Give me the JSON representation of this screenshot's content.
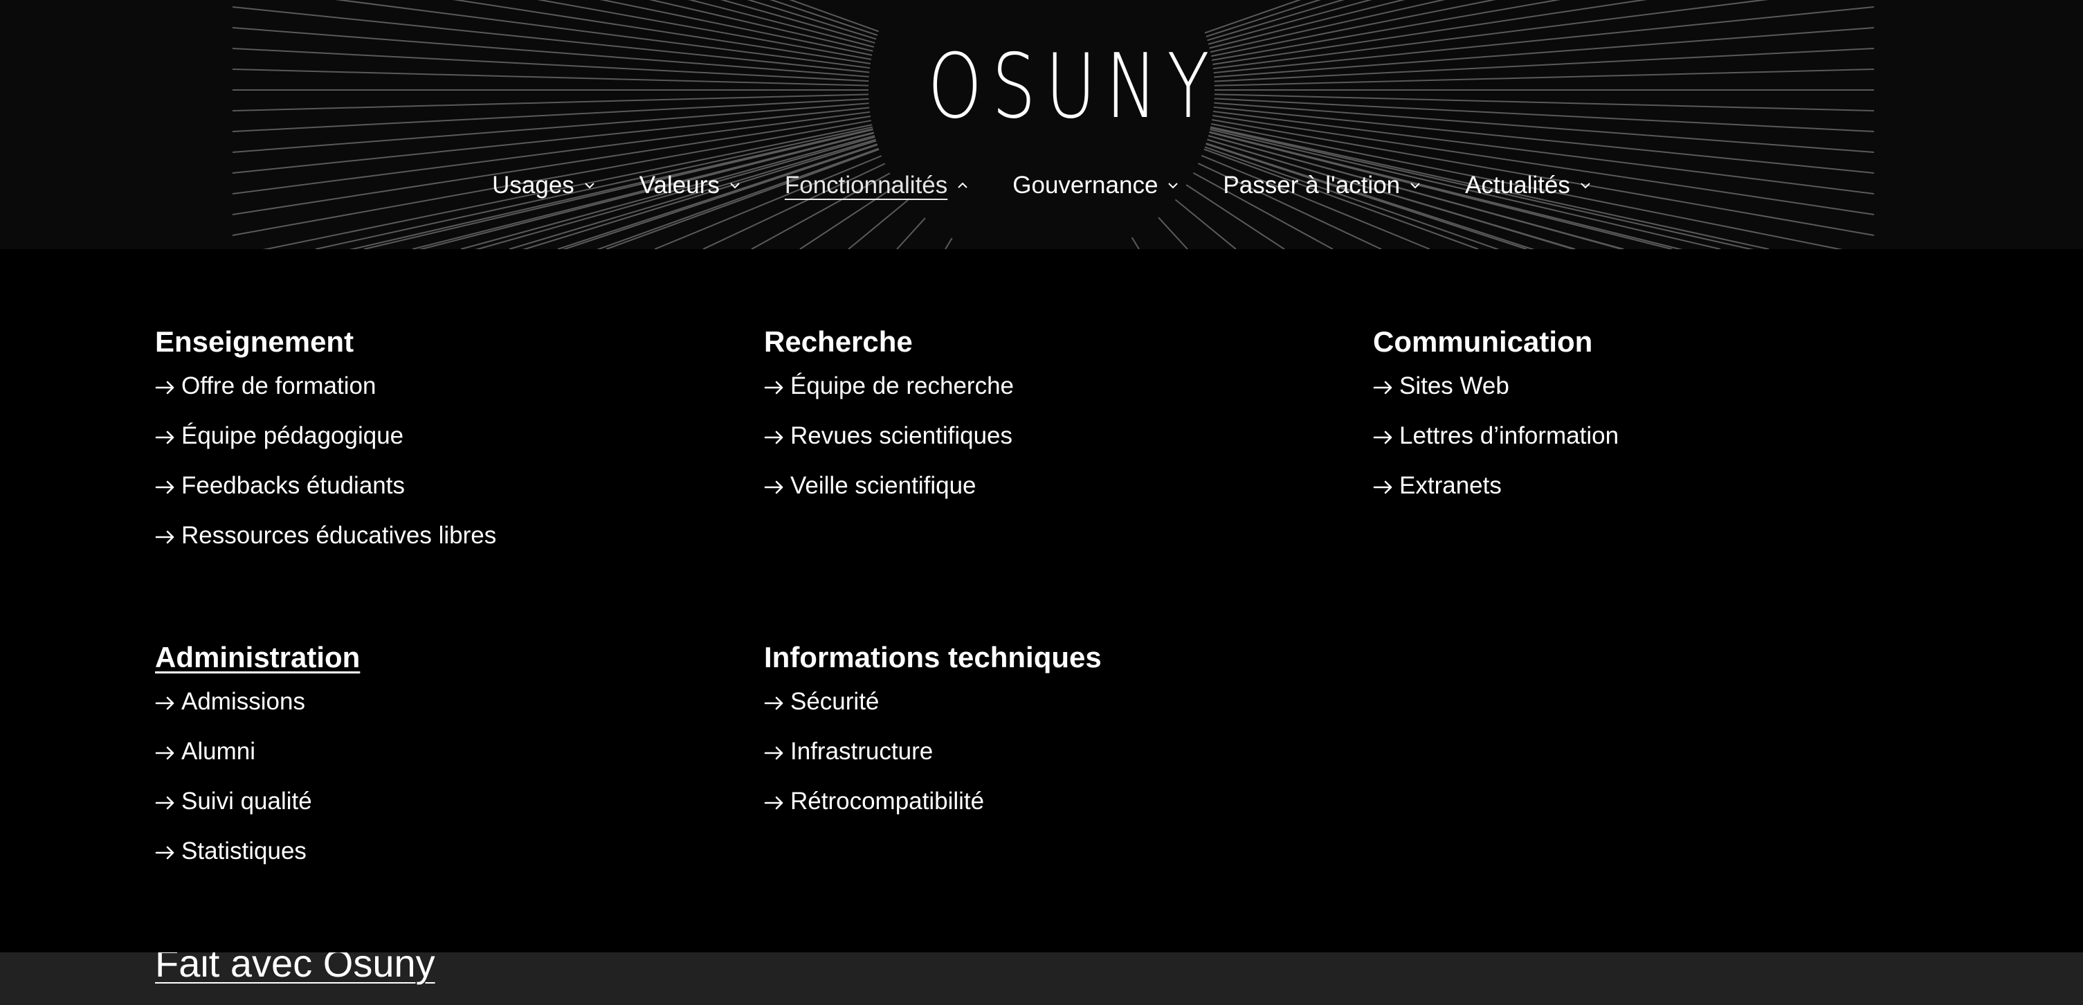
{
  "brand": {
    "logo": "OSUNY"
  },
  "nav": {
    "items": [
      {
        "label": "Usages",
        "active": false
      },
      {
        "label": "Valeurs",
        "active": false
      },
      {
        "label": "Fonctionnalités",
        "active": true
      },
      {
        "label": "Gouvernance",
        "active": false
      },
      {
        "label": "Passer à l'action",
        "active": false
      },
      {
        "label": "Actualités",
        "active": false
      }
    ]
  },
  "menu": {
    "enseignement": {
      "title": "Enseignement",
      "links": [
        "Offre de formation",
        "Équipe pédagogique",
        "Feedbacks étudiants",
        "Ressources éducatives libres"
      ]
    },
    "recherche": {
      "title": "Recherche",
      "links": [
        "Équipe de recherche",
        "Revues scientifiques",
        "Veille scientifique"
      ]
    },
    "communication": {
      "title": "Communication",
      "links": [
        "Sites Web",
        "Lettres d’information",
        "Extranets"
      ]
    },
    "administration": {
      "title": "Administration",
      "links": [
        "Admissions",
        "Alumni",
        "Suivi qualité",
        "Statistiques"
      ]
    },
    "informations": {
      "title": "Informations techniques",
      "links": [
        "Sécurité",
        "Infrastructure",
        "Rétrocompatibilité"
      ]
    }
  },
  "footer": {
    "made_with": "Fait avec Osuny"
  },
  "colors": {
    "background": "#000000",
    "header": "#0a0a0a",
    "footer": "#222222",
    "text": "#ffffff",
    "rays": "#5a5a5a"
  },
  "icons": {
    "nav_chevron": "chevron-down-icon",
    "active_chevron": "chevron-up-icon",
    "link_arrow": "arrow-right-icon"
  }
}
